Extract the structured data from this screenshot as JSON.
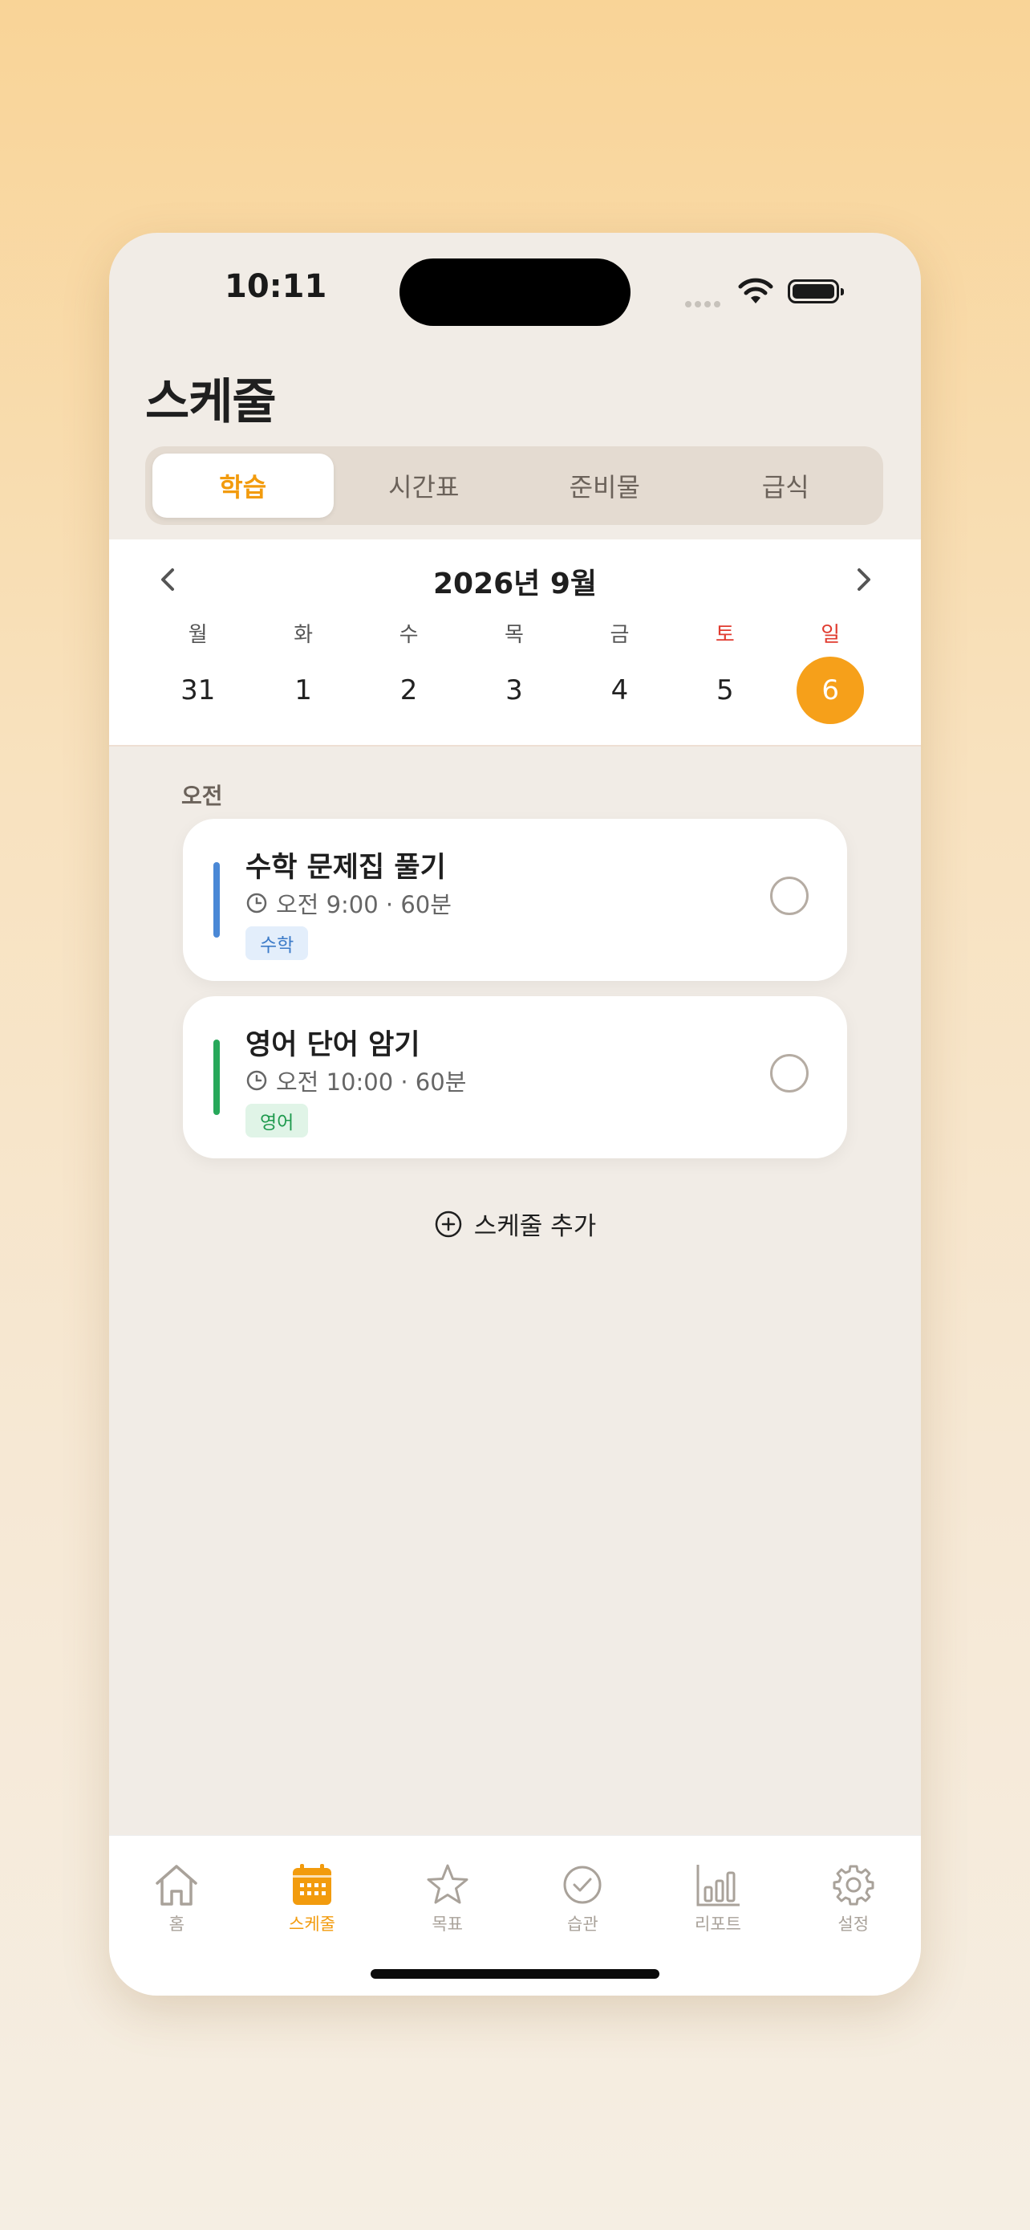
{
  "status": {
    "time": "10:11"
  },
  "header": {
    "title": "스케줄"
  },
  "segments": [
    {
      "label": "학습",
      "active": true
    },
    {
      "label": "시간표",
      "active": false
    },
    {
      "label": "준비물",
      "active": false
    },
    {
      "label": "급식",
      "active": false
    }
  ],
  "calendar": {
    "month_label": "2026년 9월",
    "weekday_labels": [
      "월",
      "화",
      "수",
      "목",
      "금",
      "토",
      "일"
    ],
    "days": [
      "31",
      "1",
      "2",
      "3",
      "4",
      "5",
      "6"
    ],
    "selected_day": "6"
  },
  "schedule": {
    "section_label": "오전",
    "items": [
      {
        "title": "수학 문제집 풀기",
        "meta": "오전 9:00 · 60분",
        "tag": "수학",
        "color": "#4A88D6",
        "tag_bg": "#E3EEFB",
        "tag_color": "#3C7BC8"
      },
      {
        "title": "영어 단어 암기",
        "meta": "오전 10:00 · 60분",
        "tag": "영어",
        "color": "#27A85A",
        "tag_bg": "#E0F4E7",
        "tag_color": "#1F9A4E"
      }
    ],
    "add_label": "스케줄 추가"
  },
  "tabbar": {
    "items": [
      {
        "label": "홈",
        "icon": "home-icon"
      },
      {
        "label": "스케줄",
        "icon": "calendar-icon",
        "active": true
      },
      {
        "label": "목표",
        "icon": "star-icon"
      },
      {
        "label": "습관",
        "icon": "check-circle-icon"
      },
      {
        "label": "리포트",
        "icon": "bar-chart-icon"
      },
      {
        "label": "설정",
        "icon": "gear-icon"
      }
    ]
  },
  "colors": {
    "accent": "#F29B0D",
    "weekend": "#E03B2F"
  }
}
